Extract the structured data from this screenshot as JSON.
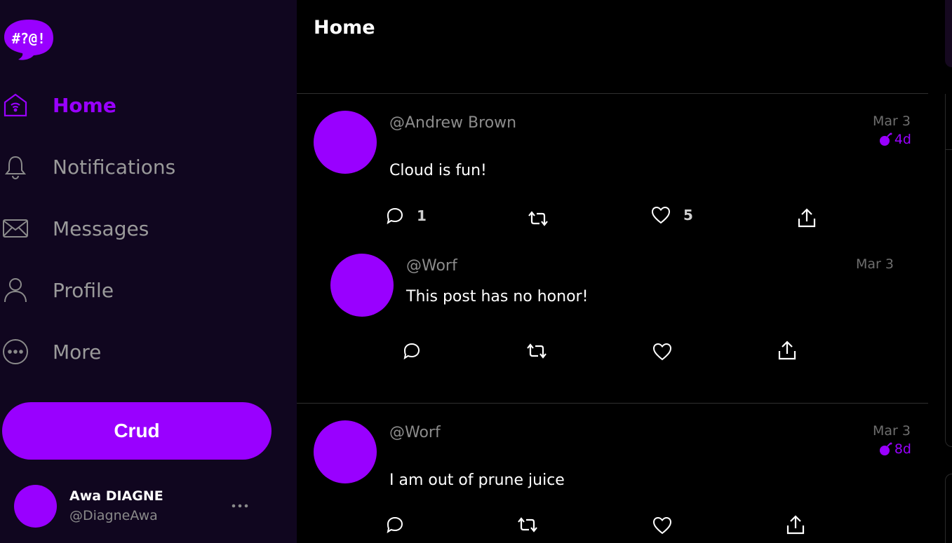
{
  "logo": {
    "text": "#?@!",
    "color": "#9900ff"
  },
  "nav": [
    {
      "label": "Home",
      "icon": "home-icon",
      "active": true
    },
    {
      "label": "Notifications",
      "icon": "bell-icon",
      "active": false
    },
    {
      "label": "Messages",
      "icon": "envelope-icon",
      "active": false
    },
    {
      "label": "Profile",
      "icon": "person-icon",
      "active": false
    },
    {
      "label": "More",
      "icon": "more-circle-icon",
      "active": false
    }
  ],
  "crud_button": "Crud",
  "account": {
    "name": "Awa DIAGNE",
    "handle": "@DiagneAwa"
  },
  "header": {
    "title": "Home"
  },
  "posts": [
    {
      "author": "@Andrew Brown",
      "date": "Mar 3",
      "age": "4d",
      "text": "Cloud is fun!",
      "replies": "1",
      "likes": "5"
    },
    {
      "author": "@Worf",
      "date": "Mar 3",
      "text": "This post has no honor!"
    },
    {
      "author": "@Worf",
      "date": "Mar 3",
      "age": "8d",
      "text": "I am out of prune juice"
    }
  ],
  "colors": {
    "accent": "#9900ff",
    "sidebar_bg": "#10061f",
    "main_bg": "#000000"
  }
}
